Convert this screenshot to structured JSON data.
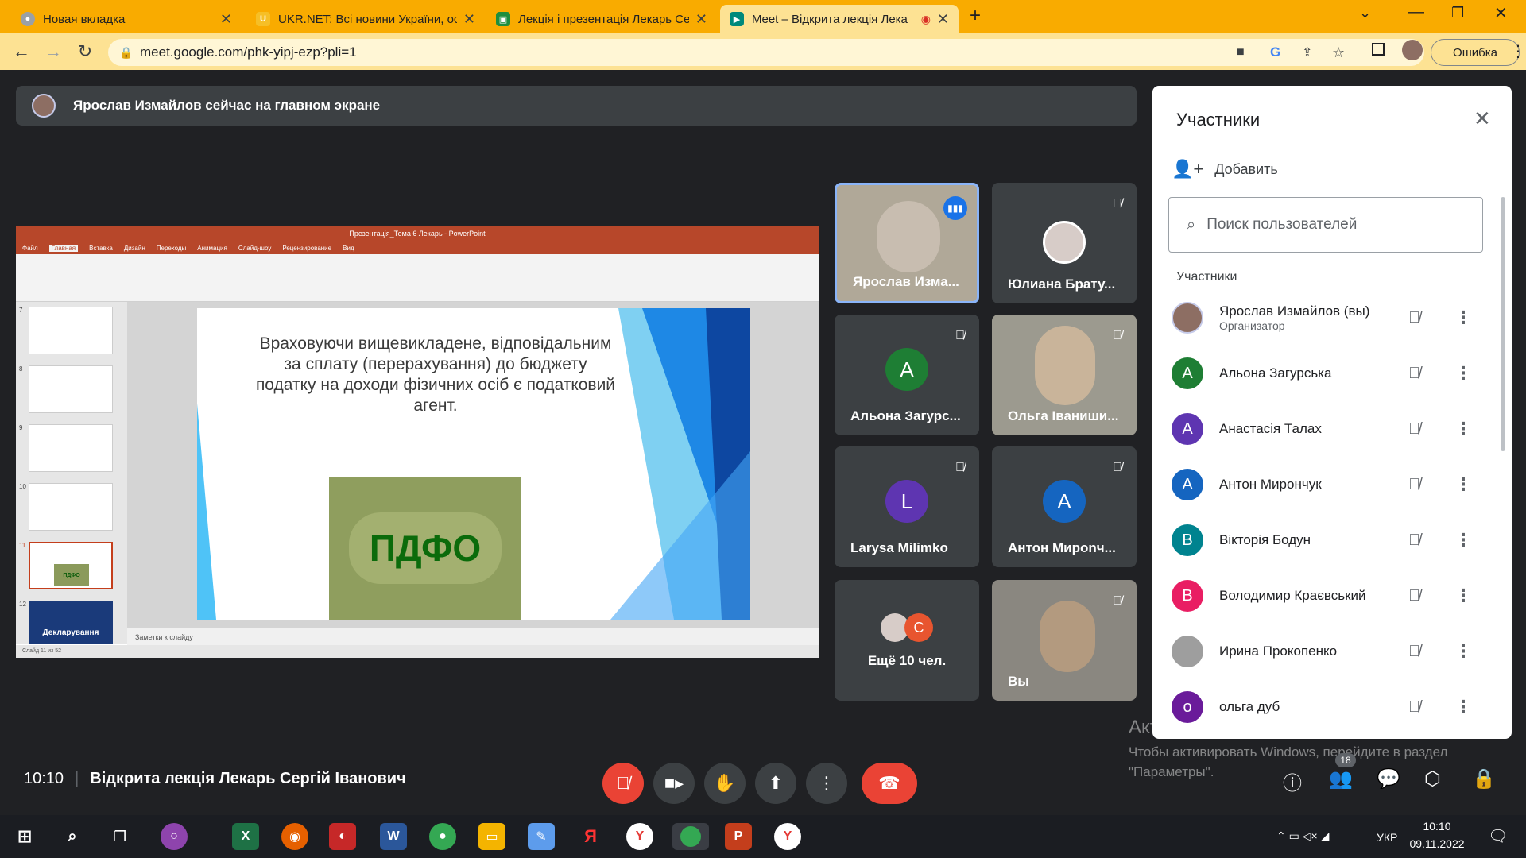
{
  "browser": {
    "tabs": [
      {
        "title": "Новая вкладка",
        "fav": "chrome-icon"
      },
      {
        "title": "UKR.NET: Всі новини України, ос",
        "fav": "ukrnet-icon"
      },
      {
        "title": "Лекція і презентація Лекарь Сер",
        "fav": "classroom-icon"
      },
      {
        "title": "Meet – Відкрита лекція Лека",
        "fav": "meet-icon"
      }
    ],
    "url": "meet.google.com/phk-yipj-ezp?pli=1",
    "error_button": "Ошибка"
  },
  "meet": {
    "banner": "Ярослав Измайлов сейчас на главном экране",
    "time": "10:10",
    "meeting_title": "Відкрита лекція Лекарь Сергій Іванович",
    "participant_count": "18",
    "tiles": [
      {
        "name": "Ярослав Изма...",
        "type": "video"
      },
      {
        "name": "Юлиана Брату...",
        "type": "photo"
      },
      {
        "name": "Альона Загурс...",
        "initial": "A",
        "color": "#1e7e34"
      },
      {
        "name": "Ольга Іваниши...",
        "type": "video"
      },
      {
        "name": "Larysa Milimko",
        "initial": "L",
        "color": "#5e35b1"
      },
      {
        "name": "Антон Мирonч...",
        "initial": "A",
        "color": "#1565c0"
      },
      {
        "name": "Ещё 10 чел.",
        "type": "more",
        "initial": "C"
      },
      {
        "name": "Вы",
        "type": "video"
      }
    ]
  },
  "panel": {
    "title": "Участники",
    "add_label": "Добавить",
    "search_placeholder": "Поиск пользователей",
    "section": "Участники",
    "participants": [
      {
        "name": "Ярослав Измайлов (вы)",
        "sub": "Организатор",
        "initial": "",
        "color": "#8d6e63"
      },
      {
        "name": "Альона Загурська",
        "initial": "A",
        "color": "#1e7e34"
      },
      {
        "name": "Анастасія Талах",
        "initial": "A",
        "color": "#5e35b1"
      },
      {
        "name": "Антон Мирончук",
        "initial": "A",
        "color": "#1565c0"
      },
      {
        "name": "Вікторія Бодун",
        "initial": "B",
        "color": "#00838f"
      },
      {
        "name": "Володимир Краєвський",
        "initial": "B",
        "color": "#e91e63"
      },
      {
        "name": "Ирина Прокопенко",
        "initial": "",
        "color": "#9e9e9e"
      },
      {
        "name": "ольга дуб",
        "initial": "o",
        "color": "#6a1b9a"
      }
    ]
  },
  "slide": {
    "ppt_title": "Презентація_Тема 6 Лекарь - PowerPoint",
    "ribbon_tabs": [
      "Файл",
      "Главная",
      "Вставка",
      "Дизайн",
      "Переходы",
      "Анимация",
      "Слайд-шоу",
      "Рецензирование",
      "Вид"
    ],
    "text": "Враховуючи вищевикладене, відповідальним за сплату (перерахування) до бюджету податку на доходи фізичних осіб є податковий агент.",
    "image_label": "ПДФО",
    "notes_label": "Заметки к слайду",
    "status": "Слайд 11 из 52",
    "thumb_numbers": [
      "7",
      "8",
      "9",
      "10",
      "11",
      "12"
    ],
    "thumb12_text": "Декларування"
  },
  "windows": {
    "activation_title": "Активация Windows",
    "activation_sub": "Чтобы активировать Windows, перейдите в раздел \"Параметры\".",
    "clock_time": "10:10",
    "clock_date": "09.11.2022",
    "lang": "УКР"
  }
}
